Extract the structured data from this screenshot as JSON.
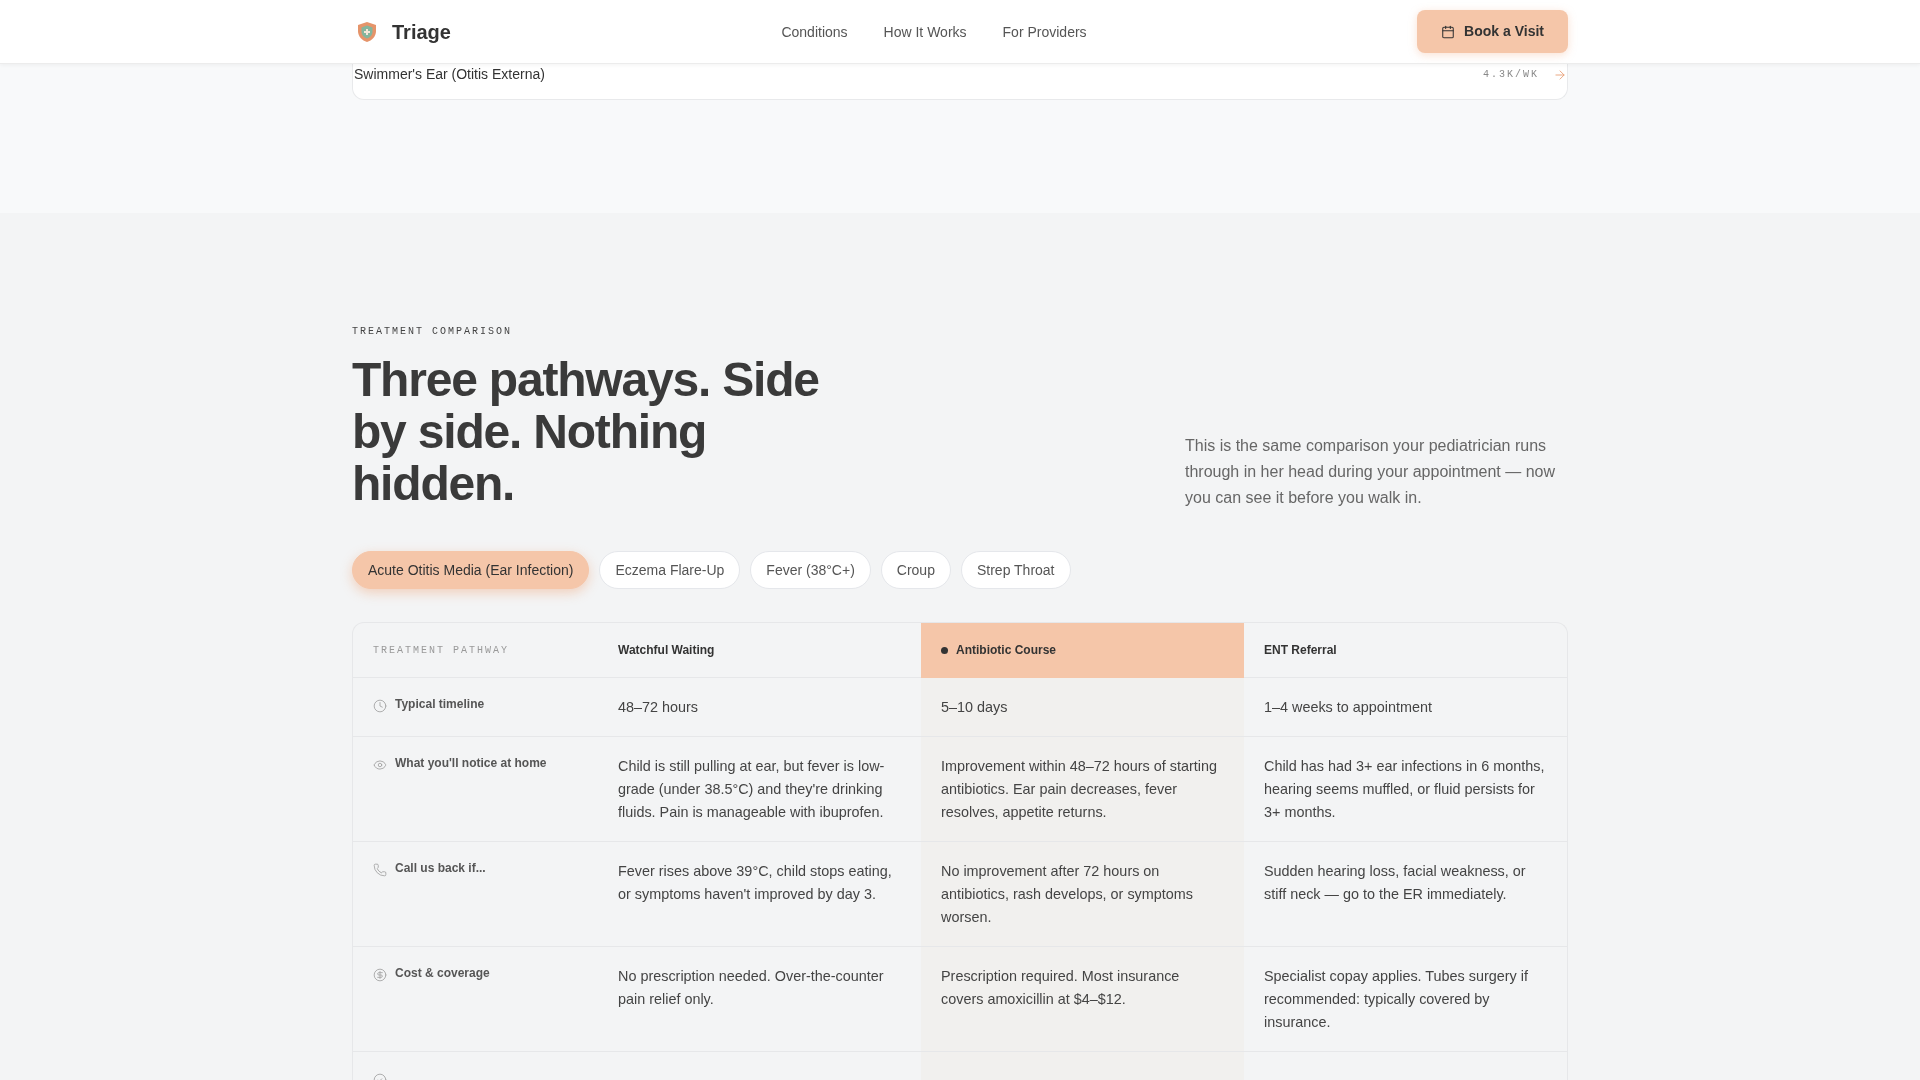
{
  "header": {
    "brand": "Triage",
    "nav": [
      "Conditions",
      "How It Works",
      "For Providers"
    ],
    "cta": "Book a Visit"
  },
  "conditions": [
    {
      "name": "Swimmer's Ear (Otitis Externa)",
      "rate": "4.3K/WK"
    }
  ],
  "comparison": {
    "eyebrow": "TREATMENT COMPARISON",
    "title": "Three pathways. Side by side. Nothing hidden.",
    "intro": "This is the same comparison your pediatrician runs through in her head during your appointment — now you can see it before you walk in.",
    "tabs": [
      {
        "label": "Acute Otitis Media (Ear Infection)",
        "selected": true
      },
      {
        "label": "Eczema Flare-Up",
        "selected": false
      },
      {
        "label": "Fever (38°C+)",
        "selected": false
      },
      {
        "label": "Croup",
        "selected": false
      },
      {
        "label": "Strep Throat",
        "selected": false
      }
    ],
    "table": {
      "corner": "TREATMENT PATHWAY",
      "columns": [
        {
          "label": "Watchful Waiting",
          "highlighted": false
        },
        {
          "label": "Antibiotic Course",
          "highlighted": true
        },
        {
          "label": "ENT Referral",
          "highlighted": false
        }
      ],
      "rows": [
        {
          "kind": "timeline",
          "label": "Typical timeline",
          "cells": [
            "48–72 hours",
            "5–10 days",
            "1–4 weeks to appointment"
          ]
        },
        {
          "kind": "notice",
          "label": "What you'll notice at home",
          "cells": [
            "Child is still pulling at ear, but fever is low-grade (under 38.5°C) and they're drinking fluids. Pain is manageable with ibuprofen.",
            "Improvement within 48–72 hours of starting antibiotics. Ear pain decreases, fever resolves, appetite returns.",
            "Child has had 3+ ear infections in 6 months, hearing seems muffled, or fluid persists for 3+ months."
          ]
        },
        {
          "kind": "callback",
          "label": "Call us back if...",
          "cells": [
            "Fever rises above 39°C, child stops eating, or symptoms haven't improved by day 3.",
            "No improvement after 72 hours on antibiotics, rash develops, or symptoms worsen.",
            "Sudden hearing loss, facial weakness, or stiff neck — go to the ER immediately."
          ]
        },
        {
          "kind": "cost",
          "label": "Cost & coverage",
          "cells": [
            "No prescription needed. Over-the-counter pain relief only.",
            "Prescription required. Most insurance covers amoxicillin at $4–$12.",
            "Specialist copay applies. Tubes surgery if recommended: typically covered by insurance."
          ]
        },
        {
          "kind": "recommended"
        }
      ]
    }
  }
}
